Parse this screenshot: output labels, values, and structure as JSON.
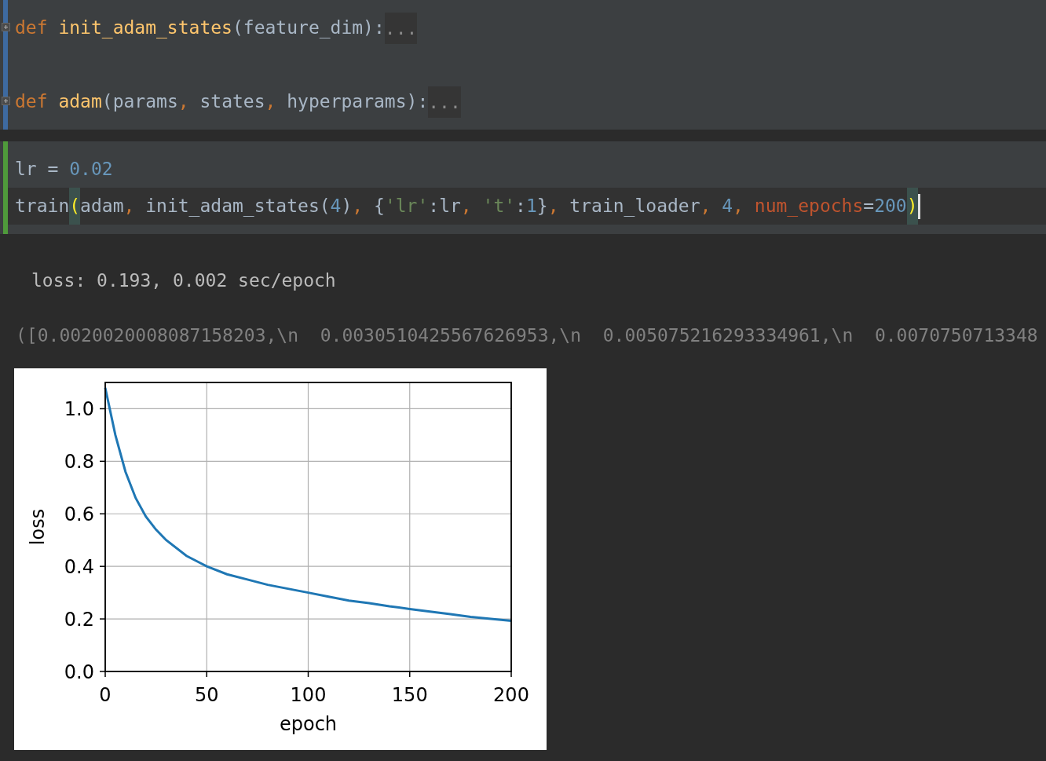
{
  "cells": [
    {
      "color": "#3e6aa0",
      "lines": [
        {
          "folded": true,
          "current": false,
          "cursor": false,
          "tokens": [
            {
              "kind": "keyword",
              "text": "def"
            },
            {
              "kind": "function",
              "text": " init_adam_states"
            },
            {
              "kind": "plain",
              "text": "(feature_dim):"
            },
            {
              "kind": "fold",
              "text": "..."
            }
          ]
        },
        {
          "folded": true,
          "current": false,
          "cursor": false,
          "tokens": [
            {
              "kind": "keyword",
              "text": "def"
            },
            {
              "kind": "function",
              "text": " adam"
            },
            {
              "kind": "plain",
              "text": "(params"
            },
            {
              "kind": "comma",
              "text": ","
            },
            {
              "kind": "plain",
              "text": " states"
            },
            {
              "kind": "comma",
              "text": ","
            },
            {
              "kind": "plain",
              "text": " hyperparams):"
            },
            {
              "kind": "fold",
              "text": "..."
            }
          ]
        }
      ]
    },
    {
      "color": "#4f9a3b",
      "lines": [
        {
          "folded": false,
          "current": false,
          "cursor": false,
          "tokens": [
            {
              "kind": "plain",
              "text": "lr = "
            },
            {
              "kind": "number",
              "text": "0.02"
            }
          ]
        },
        {
          "folded": false,
          "current": true,
          "cursor": true,
          "tokens": [
            {
              "kind": "plain",
              "text": "train"
            },
            {
              "kind": "match",
              "text": "("
            },
            {
              "kind": "plain",
              "text": "adam"
            },
            {
              "kind": "comma",
              "text": ","
            },
            {
              "kind": "plain",
              "text": " init_adam_states("
            },
            {
              "kind": "number",
              "text": "4"
            },
            {
              "kind": "plain",
              "text": ")"
            },
            {
              "kind": "comma",
              "text": ","
            },
            {
              "kind": "plain",
              "text": " {"
            },
            {
              "kind": "string",
              "text": "'lr'"
            },
            {
              "kind": "plain",
              "text": ":lr"
            },
            {
              "kind": "comma",
              "text": ", "
            },
            {
              "kind": "string",
              "text": "'t'"
            },
            {
              "kind": "plain",
              "text": ":"
            },
            {
              "kind": "number",
              "text": "1"
            },
            {
              "kind": "plain",
              "text": "}"
            },
            {
              "kind": "comma",
              "text": ","
            },
            {
              "kind": "plain",
              "text": " train_loader"
            },
            {
              "kind": "comma",
              "text": ", "
            },
            {
              "kind": "number",
              "text": "4"
            },
            {
              "kind": "comma",
              "text": ", "
            },
            {
              "kind": "named_arg",
              "text": "num_epochs"
            },
            {
              "kind": "plain",
              "text": "="
            },
            {
              "kind": "number",
              "text": "200"
            },
            {
              "kind": "match",
              "text": ")"
            }
          ]
        }
      ]
    }
  ],
  "output": {
    "stdout": "loss: 0.193, 0.002 sec/epoch",
    "result": "([0.0020020008087158203,\\n  0.0030510425567626953,\\n  0.005075216293334961,\\n  0.0070750713348",
    "chart_data": {
      "type": "line",
      "grid": true,
      "xlabel": "epoch",
      "ylabel": "loss",
      "x": [
        0,
        5,
        10,
        15,
        20,
        25,
        30,
        40,
        50,
        60,
        70,
        80,
        90,
        100,
        110,
        120,
        130,
        140,
        150,
        160,
        170,
        180,
        190,
        200
      ],
      "series": [
        {
          "color": "#1f77b4",
          "values": [
            1.08,
            0.9,
            0.76,
            0.66,
            0.59,
            0.54,
            0.5,
            0.44,
            0.4,
            0.37,
            0.35,
            0.33,
            0.315,
            0.3,
            0.285,
            0.27,
            0.26,
            0.248,
            0.238,
            0.228,
            0.218,
            0.208,
            0.2,
            0.193
          ]
        }
      ],
      "xlim": [
        0,
        200
      ],
      "ylim": [
        0,
        1.1
      ],
      "xticks": [
        0,
        50,
        100,
        150,
        200
      ],
      "yticks": [
        {
          "value": 0,
          "label": "0.0"
        },
        {
          "value": 0.2,
          "label": "0.2"
        },
        {
          "value": 0.4,
          "label": "0.4"
        },
        {
          "value": 0.6,
          "label": "0.6"
        },
        {
          "value": 0.8,
          "label": "0.8"
        },
        {
          "value": 1.0,
          "label": "1.0"
        }
      ]
    }
  }
}
